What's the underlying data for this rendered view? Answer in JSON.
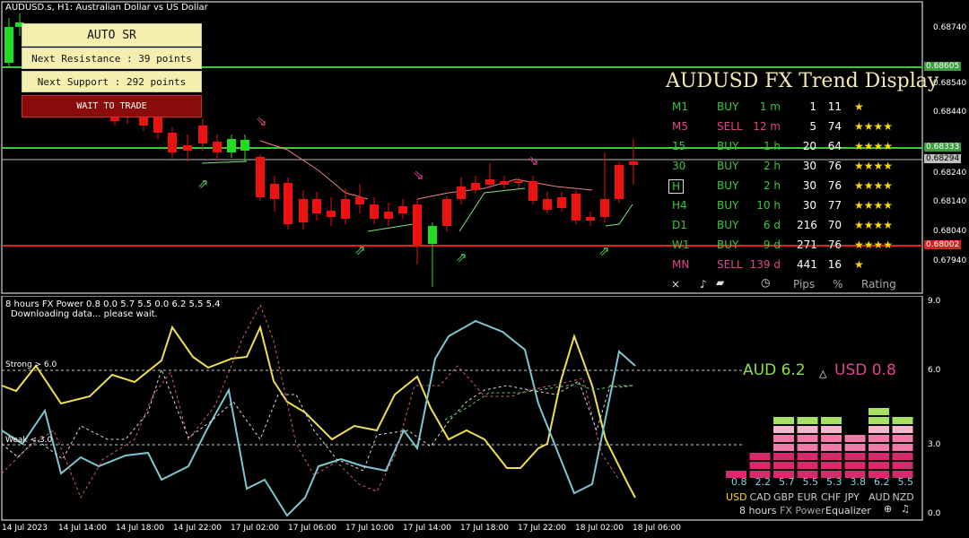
{
  "window": {
    "symbol_title": "AUDUSD.s, H1:  Australian Dollar vs US Dollar",
    "indicator_title": "8 hours FX Power 0.8 0.0 5.7 5.5 0.0 6.2 5.5 5.4",
    "downloading_text": "Downloading data... please wait."
  },
  "auto_sr": {
    "title": "AUTO  SR",
    "next_resistance": "Next Resistance : 39 points",
    "next_support": "Next Support : 292 points",
    "status": "WAIT TO TRADE"
  },
  "price_axis": [
    "0.68740",
    "0.68540",
    "0.68440",
    "0.68240",
    "0.68140",
    "0.68040",
    "0.67940"
  ],
  "price_tags": [
    {
      "value": "0.68605",
      "color": "#3c9e3c"
    },
    {
      "value": "0.68333",
      "color": "#3c9e3c"
    },
    {
      "value": "0.68294",
      "color": "#c0c0c0"
    },
    {
      "value": "0.68002",
      "color": "#e02020"
    }
  ],
  "trend_display": {
    "title": "AUDUSD FX Trend Display",
    "rows": [
      {
        "tf": "M1",
        "signal": "BUY",
        "age": "1 m",
        "pips": "1",
        "pct": "11",
        "stars": "★",
        "buy": true
      },
      {
        "tf": "M5",
        "signal": "SELL",
        "age": "12 m",
        "pips": "5",
        "pct": "74",
        "stars": "★★★★",
        "buy": false
      },
      {
        "tf": "15",
        "signal": "BUY",
        "age": "1 h",
        "pips": "20",
        "pct": "64",
        "stars": "★★★★",
        "buy": true
      },
      {
        "tf": "30",
        "signal": "BUY",
        "age": "2 h",
        "pips": "30",
        "pct": "76",
        "stars": "★★★★",
        "buy": true
      },
      {
        "tf": "H",
        "signal": "BUY",
        "age": "2 h",
        "pips": "30",
        "pct": "76",
        "stars": "★★★★",
        "buy": true
      },
      {
        "tf": "H4",
        "signal": "BUY",
        "age": "10 h",
        "pips": "30",
        "pct": "77",
        "stars": "★★★★",
        "buy": true
      },
      {
        "tf": "D1",
        "signal": "BUY",
        "age": "6 d",
        "pips": "216",
        "pct": "70",
        "stars": "★★★★",
        "buy": true
      },
      {
        "tf": "W1",
        "signal": "BUY",
        "age": "9 d",
        "pips": "271",
        "pct": "76",
        "stars": "★★★★",
        "buy": true
      },
      {
        "tf": "MN",
        "signal": "SELL",
        "age": "139 d",
        "pips": "441",
        "pct": "16",
        "stars": "★",
        "buy": false
      }
    ],
    "footer": {
      "close": "×",
      "pips": "Pips",
      "pct": "%",
      "rating": "Rating"
    }
  },
  "power": {
    "strong_label": "Strong > 6.0",
    "weak_label": "Weak < 3.0",
    "base": "AUD 6.2",
    "quote": "USD 0.8",
    "delta": "△",
    "axis": [
      "9.0",
      "6.0",
      "3.0",
      "0.0"
    ]
  },
  "equalizer": {
    "currencies": [
      "USD",
      "CAD",
      "GBP",
      "EUR",
      "CHF",
      "JPY",
      "AUD",
      "NZD"
    ],
    "values": [
      "0.8",
      "2.2",
      "5.7",
      "5.5",
      "5.3",
      "3.8",
      "6.2",
      "5.5"
    ],
    "footer": {
      "period": "8 hours",
      "name": "FX Power",
      "mode": "Equalizer"
    }
  },
  "time_axis": [
    "14 Jul 2023",
    "14 Jul 14:00",
    "14 Jul 18:00",
    "14 Jul 22:00",
    "17 Jul 02:00",
    "17 Jul 06:00",
    "17 Jul 10:00",
    "17 Jul 14:00",
    "17 Jul 18:00",
    "17 Jul 22:00",
    "18 Jul 02:00",
    "18 Jul 06:00"
  ],
  "colors": {
    "bull": "#22dd22",
    "bear": "#ee1111",
    "support": "#e02020",
    "resistance": "#3cc83c",
    "aud": "#8ee04a",
    "usd": "#e0458f"
  }
}
